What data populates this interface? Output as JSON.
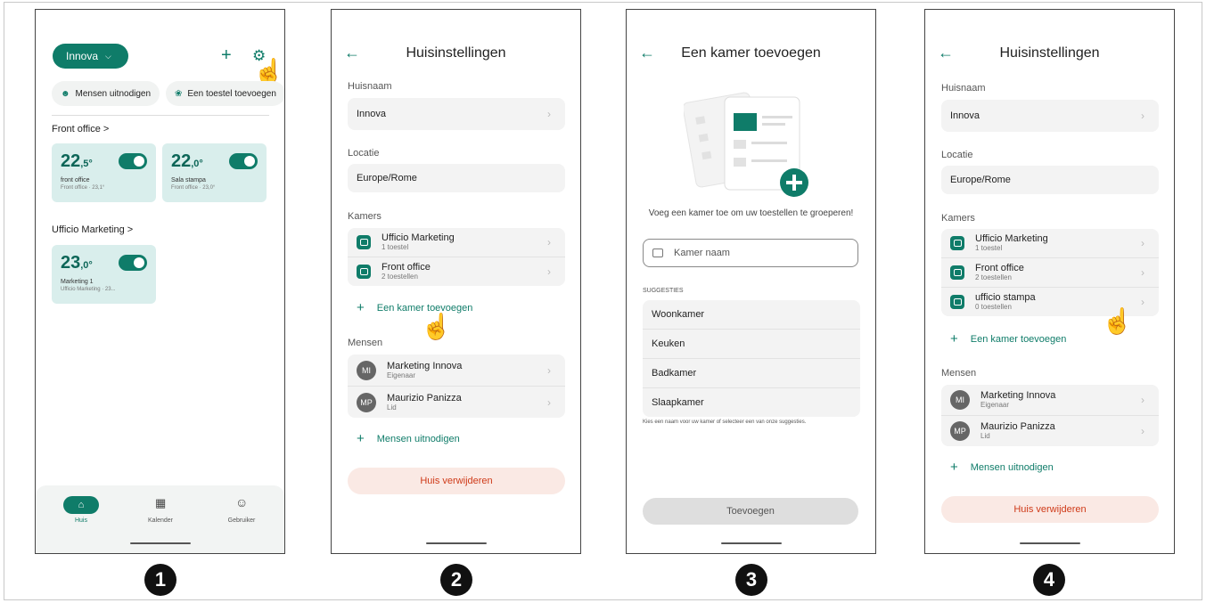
{
  "steps": [
    "1",
    "2",
    "3",
    "4"
  ],
  "screen1": {
    "home_button": "Innova",
    "invite_chip": "Mensen uitnodigen",
    "add_device_chip": "Een toestel toevoegen",
    "rooms": [
      {
        "title": "Front office >",
        "devices": [
          {
            "temp": "22",
            "decimal": ",5°",
            "name": "front office",
            "sub": "Front office · 23,1°"
          },
          {
            "temp": "22",
            "decimal": ",0°",
            "name": "Sala stampa",
            "sub": "Front office · 23,0°"
          }
        ]
      },
      {
        "title": "Ufficio Marketing >",
        "devices": [
          {
            "temp": "23",
            "decimal": ",0°",
            "name": "Marketing 1",
            "sub": "Ufficio Marketing · 23..."
          }
        ]
      }
    ],
    "nav": [
      "Huis",
      "Kalender",
      "Gebruiker"
    ]
  },
  "settings": {
    "title": "Huisinstellingen",
    "house_name_label": "Huisnaam",
    "house_name": "Innova",
    "location_label": "Locatie",
    "location": "Europe/Rome",
    "rooms_label": "Kamers",
    "add_room": "Een kamer toevoegen",
    "people_label": "Mensen",
    "people": [
      {
        "initials": "MI",
        "name": "Marketing Innova",
        "role": "Eigenaar"
      },
      {
        "initials": "MP",
        "name": "Maurizio Panizza",
        "role": "Lid"
      }
    ],
    "invite": "Mensen uitnodigen",
    "delete": "Huis verwijderen"
  },
  "screen2": {
    "rooms": [
      {
        "name": "Ufficio Marketing",
        "count": "1 toestel"
      },
      {
        "name": "Front office",
        "count": "2 toestellen"
      }
    ]
  },
  "screen3": {
    "title": "Een kamer toevoegen",
    "prompt": "Voeg een kamer toe om uw toestellen te groeperen!",
    "input_placeholder": "Kamer naam",
    "suggestions_label": "SUGGESTIES",
    "suggestions": [
      "Woonkamer",
      "Keuken",
      "Badkamer",
      "Slaapkamer"
    ],
    "hint": "Kies een naam voor uw kamer of selecteer een van onze suggesties.",
    "add_button": "Toevoegen"
  },
  "screen4": {
    "rooms": [
      {
        "name": "Ufficio Marketing",
        "count": "1 toestel"
      },
      {
        "name": "Front office",
        "count": "2 toestellen"
      },
      {
        "name": "ufficio stampa",
        "count": "0 toestellen"
      }
    ]
  },
  "colors": {
    "accent": "#0f7c69",
    "tile": "#d9eeec",
    "danger": "#cf3a18"
  }
}
